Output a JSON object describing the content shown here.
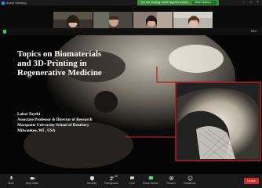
{
  "window": {
    "title": "Zoom Meeting"
  },
  "banner": {
    "text": "You are viewing Lobat Tayebi's screen",
    "view_options": "View Options ⌄"
  },
  "participants": [
    {
      "name": "Liliana Liverani"
    },
    {
      "name": "Aldo Boccaccini"
    },
    {
      "name": "Lobat Tayebi"
    },
    {
      "name": "Lobat BBCZ"
    }
  ],
  "share_bar": {
    "record_label": "REC"
  },
  "slide": {
    "title_lines": [
      "Topics on Biomaterials",
      "and 3D-Printing in",
      "Regenerative Medicine"
    ],
    "author_lines": [
      "Lobat Tayebi",
      "Associate Professor & Director of Research",
      "Marquette University School of Dentistry",
      "Milwaukee, WI , USA"
    ]
  },
  "toolbar": {
    "mute": "Mute",
    "stop_video": "Stop Video",
    "security": "Security",
    "participants": "Participants",
    "participants_count": "28",
    "chat": "Chat",
    "share_screen": "Share Screen",
    "record": "Record",
    "reactions": "Reactions",
    "leave": "Leave"
  },
  "colors": {
    "accent_green": "#3a8d3d",
    "share_green": "#3ecb55",
    "leave_red": "#c9302c",
    "slide_frame_red": "#b01e1e"
  }
}
